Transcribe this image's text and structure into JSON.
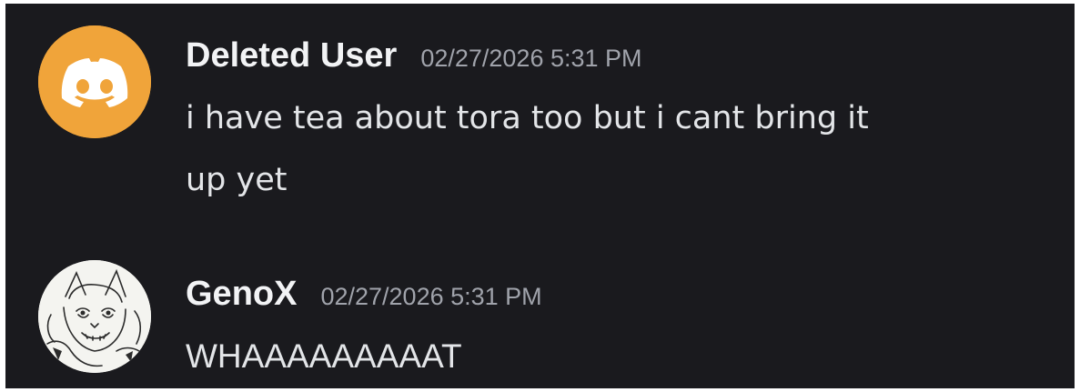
{
  "messages": [
    {
      "username": "Deleted User",
      "timestamp": "02/27/2026 5:31 PM",
      "avatar_icon": "discord-logo-icon",
      "avatar_color": "#f0a43a",
      "lines": [
        "i have tea about tora too but i cant bring it",
        "up yet"
      ]
    },
    {
      "username": "GenoX",
      "timestamp": "02/27/2026 5:31 PM",
      "avatar_icon": "sketch-character-avatar",
      "lines": [
        "WHAAAAAAAAAT"
      ]
    }
  ],
  "colors": {
    "background": "#1a1a1e",
    "username": "#f2f3f5",
    "timestamp": "#a0a3ab",
    "text": "#e3e5e8"
  }
}
